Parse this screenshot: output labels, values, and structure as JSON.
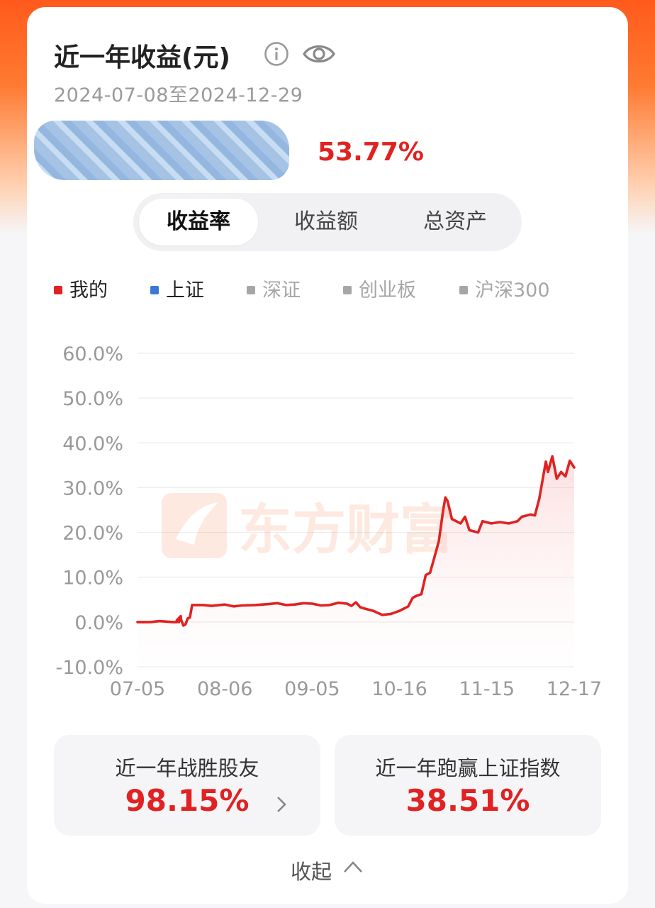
{
  "header": {
    "title": "近一年收益(元)",
    "date_range": "2024-07-08至2024-12-29",
    "total_return": "53.77%",
    "icons": [
      "info-icon",
      "eye-icon"
    ]
  },
  "tabs": [
    {
      "label": "收益率",
      "active": true
    },
    {
      "label": "收益额",
      "active": false
    },
    {
      "label": "总资产",
      "active": false
    }
  ],
  "legend": [
    {
      "label": "我的",
      "color": "#e02222",
      "active": true
    },
    {
      "label": "上证",
      "color": "#3a78d8",
      "active": true
    },
    {
      "label": "深证",
      "color": "#a6a6a6",
      "active": false
    },
    {
      "label": "创业板",
      "color": "#a6a6a6",
      "active": false
    },
    {
      "label": "沪深300",
      "color": "#a6a6a6",
      "active": false
    }
  ],
  "chart_data": {
    "type": "line",
    "x_ticks": [
      "07-05",
      "08-06",
      "09-05",
      "10-16",
      "11-15",
      "12-17"
    ],
    "y_ticks": [
      "60.0%",
      "50.0%",
      "40.0%",
      "30.0%",
      "20.0%",
      "10.0%",
      "0.0%",
      "-10.0%"
    ],
    "ylim": [
      -10,
      60
    ],
    "xlim": [
      0,
      1
    ],
    "grid": true,
    "watermark": "东方财富",
    "series": [
      {
        "name": "我的",
        "color": "#e02222",
        "area_fill": true,
        "points": [
          [
            0,
            0
          ],
          [
            0.03,
            0
          ],
          [
            0.05,
            0.2
          ],
          [
            0.08,
            0
          ],
          [
            0.09,
            0
          ],
          [
            0.1,
            0.3
          ],
          [
            0.095,
            0
          ],
          [
            0.1,
            0.4
          ],
          [
            0.09,
            0
          ],
          [
            0.09,
            0
          ],
          [
            0.09,
            0
          ],
          [
            0.09,
            0.1
          ],
          [
            0.09,
            0.2
          ],
          [
            0.09,
            0.3
          ],
          [
            0.09,
            0.4
          ],
          [
            0.091,
            0.5
          ],
          [
            0.092,
            0.6
          ],
          [
            0.093,
            0.7
          ],
          [
            0.094,
            0.8
          ],
          [
            0.095,
            0.9
          ],
          [
            0.096,
            1.0
          ],
          [
            0.097,
            1.1
          ],
          [
            0.098,
            1.2
          ],
          [
            0.099,
            1.3
          ],
          [
            0.1,
            0.5
          ],
          [
            0.105,
            -0.8
          ],
          [
            0.11,
            -0.5
          ],
          [
            0.115,
            0.8
          ],
          [
            0.12,
            1.0
          ],
          [
            0.125,
            3.8
          ],
          [
            0.15,
            3.8
          ],
          [
            0.17,
            3.6
          ],
          [
            0.2,
            3.9
          ],
          [
            0.22,
            3.5
          ],
          [
            0.24,
            3.7
          ],
          [
            0.27,
            3.8
          ],
          [
            0.3,
            4.0
          ],
          [
            0.32,
            4.2
          ],
          [
            0.34,
            3.8
          ],
          [
            0.36,
            3.9
          ],
          [
            0.38,
            4.2
          ],
          [
            0.4,
            4.1
          ],
          [
            0.42,
            3.7
          ],
          [
            0.44,
            3.8
          ],
          [
            0.46,
            4.3
          ],
          [
            0.48,
            4.1
          ],
          [
            0.49,
            3.6
          ],
          [
            0.5,
            4.4
          ],
          [
            0.51,
            3.3
          ],
          [
            0.52,
            3.0
          ],
          [
            0.54,
            2.5
          ],
          [
            0.56,
            1.6
          ],
          [
            0.58,
            1.8
          ],
          [
            0.6,
            2.5
          ],
          [
            0.62,
            3.5
          ],
          [
            0.63,
            5.4
          ],
          [
            0.64,
            5.9
          ],
          [
            0.65,
            6.2
          ],
          [
            0.66,
            10.5
          ],
          [
            0.67,
            11.0
          ],
          [
            0.68,
            14.5
          ],
          [
            0.69,
            18.0
          ],
          [
            0.7,
            25.0
          ],
          [
            0.705,
            27.8
          ],
          [
            0.71,
            27.0
          ],
          [
            0.72,
            23.0
          ],
          [
            0.74,
            22.0
          ],
          [
            0.75,
            23.5
          ],
          [
            0.76,
            20.5
          ],
          [
            0.78,
            20.0
          ],
          [
            0.79,
            22.5
          ],
          [
            0.81,
            22.0
          ],
          [
            0.83,
            22.3
          ],
          [
            0.85,
            22.0
          ],
          [
            0.87,
            22.5
          ],
          [
            0.88,
            23.5
          ],
          [
            0.9,
            24.0
          ],
          [
            0.91,
            23.8
          ],
          [
            0.92,
            27.5
          ],
          [
            0.935,
            35.8
          ],
          [
            0.94,
            33.5
          ],
          [
            0.95,
            37.0
          ],
          [
            0.96,
            32.0
          ],
          [
            0.97,
            33.5
          ],
          [
            0.98,
            32.5
          ],
          [
            0.99,
            36.0
          ],
          [
            1.0,
            34.5
          ]
        ]
      },
      {
        "name": "上证",
        "color": "#3a78d8",
        "area_fill": false,
        "points": []
      }
    ]
  },
  "stats": [
    {
      "label": "近一年战胜股友",
      "value": "98.15%",
      "has_arrow": true
    },
    {
      "label": "近一年跑赢上证指数",
      "value": "38.51%",
      "has_arrow": false
    }
  ],
  "collapse_label": "收起"
}
